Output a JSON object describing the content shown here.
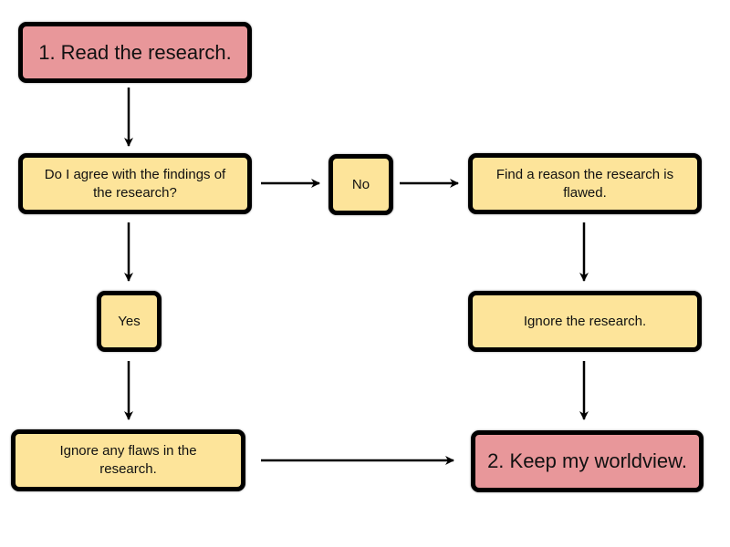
{
  "colors": {
    "start_end_fill": "#e8979a",
    "step_fill": "#fde49a",
    "outline": "#000000"
  },
  "nodes": {
    "start": "1. Read the research.",
    "question": "Do I agree with the findings of the research?",
    "no": "No",
    "find_reason": "Find a reason the research is flawed.",
    "yes": "Yes",
    "ignore_research": "Ignore the research.",
    "ignore_flaws": "Ignore any flaws in the research.",
    "end": "2. Keep my worldview."
  }
}
